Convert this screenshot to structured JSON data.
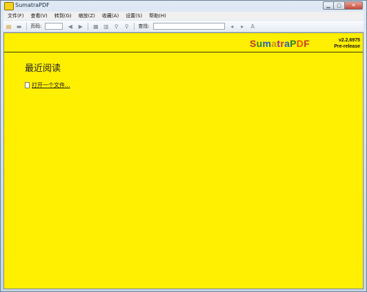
{
  "window": {
    "title": "SumatraPDF"
  },
  "menu": [
    "文件(F)",
    "查看(V)",
    "转到(G)",
    "缩放(Z)",
    "收藏(A)",
    "设置(S)",
    "帮助(H)"
  ],
  "toolbar": {
    "page_label": "页码:",
    "find_label": "查找:"
  },
  "brand": {
    "letters": [
      "S",
      "u",
      "m",
      "a",
      "t",
      "r",
      "a",
      "P",
      "D",
      "F"
    ],
    "colors": [
      "#c0392b",
      "#2e7d32",
      "#1f5fbf",
      "#c49a00",
      "#8e24aa",
      "#c0392b",
      "#1f5fbf",
      "#2e7d32",
      "#e65100",
      "#c0392b"
    ],
    "version": "v2.2.6975",
    "release": "Pre-release"
  },
  "content": {
    "heading": "最近阅读",
    "open_file": "打开一个文件..."
  }
}
